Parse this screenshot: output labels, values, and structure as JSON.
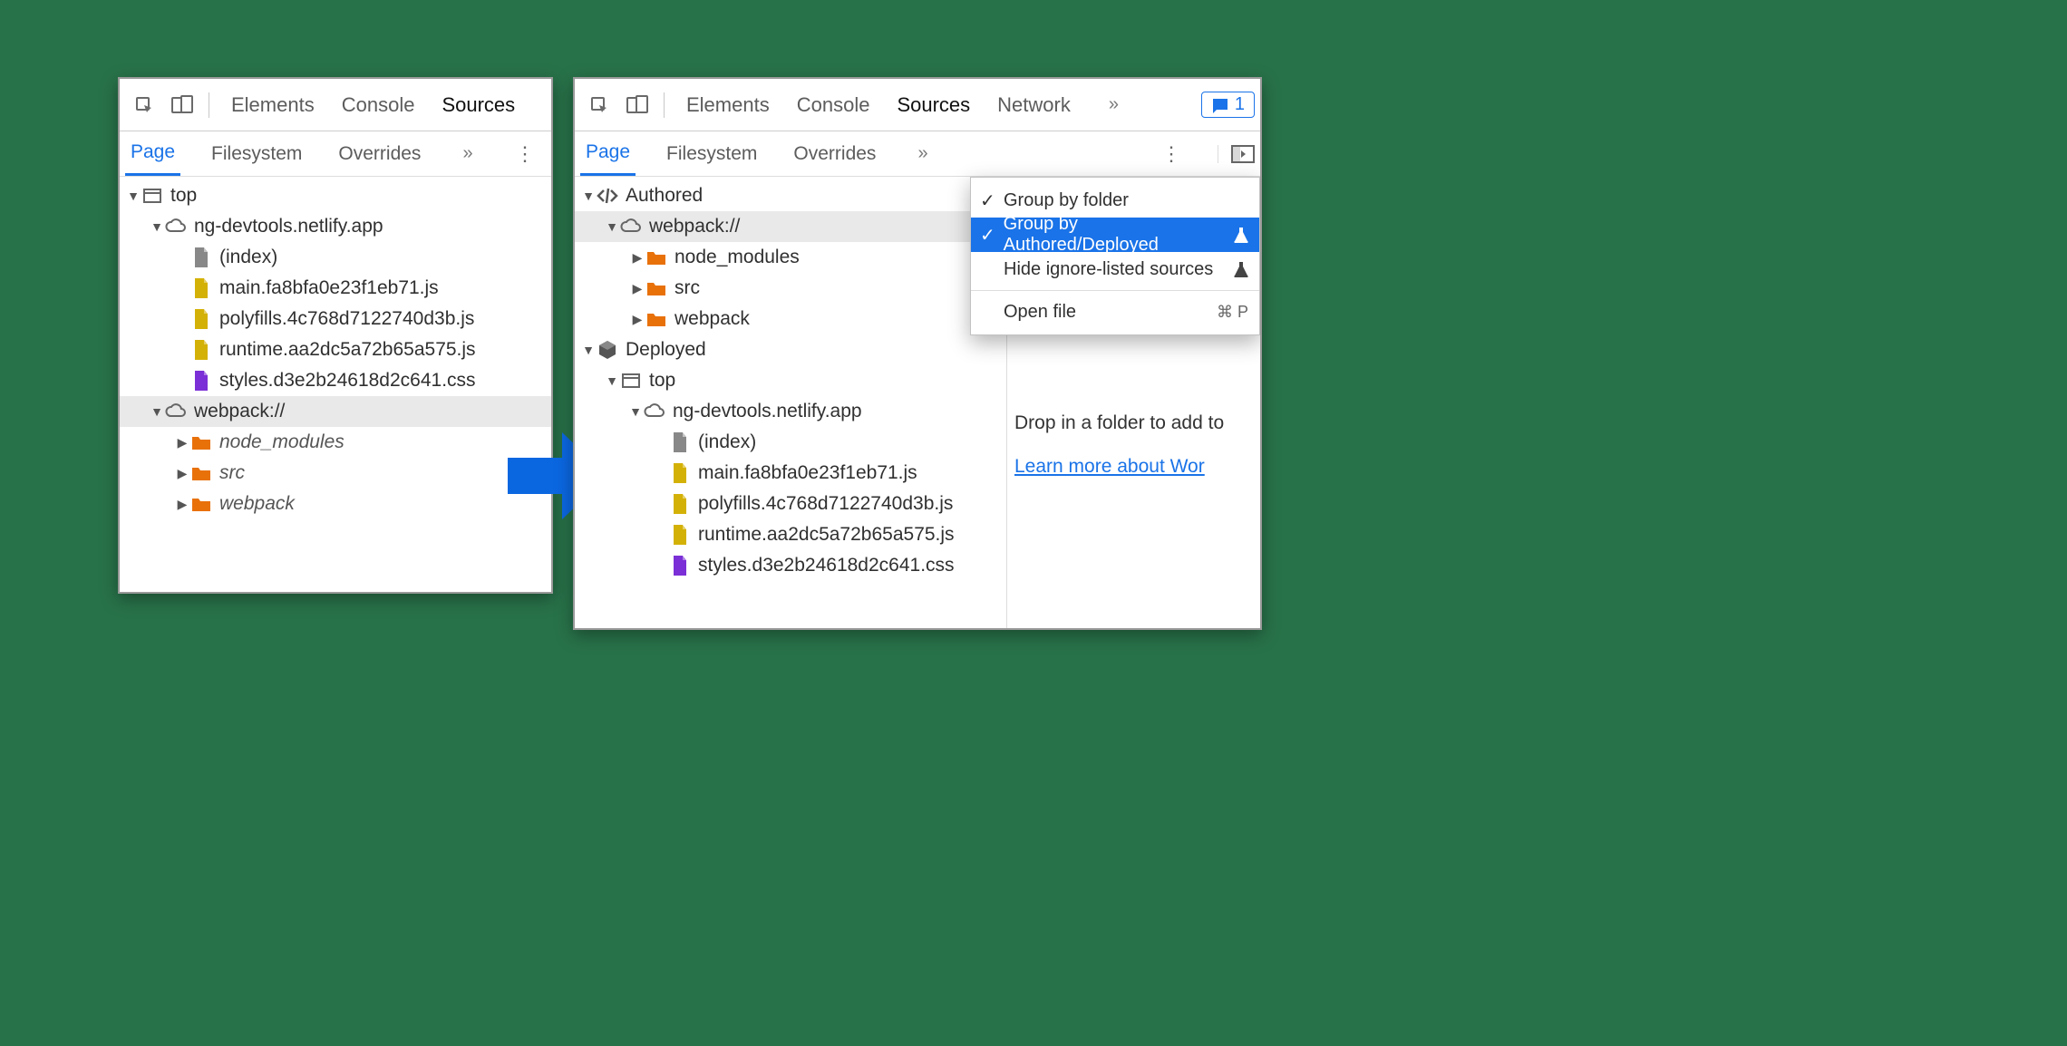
{
  "left": {
    "main_tabs": [
      "Elements",
      "Console",
      "Sources"
    ],
    "main_active": "Sources",
    "sub_tabs": [
      "Page",
      "Filesystem",
      "Overrides"
    ],
    "sub_active": "Page",
    "tree": {
      "top": "top",
      "domain": "ng-devtools.netlify.app",
      "files": [
        {
          "name": "(index)",
          "type": "gray"
        },
        {
          "name": "main.fa8bfa0e23f1eb71.js",
          "type": "yellow"
        },
        {
          "name": "polyfills.4c768d7122740d3b.js",
          "type": "yellow"
        },
        {
          "name": "runtime.aa2dc5a72b65a575.js",
          "type": "yellow"
        },
        {
          "name": "styles.d3e2b24618d2c641.css",
          "type": "purple"
        }
      ],
      "webpack": "webpack://",
      "webpack_folders": [
        "node_modules",
        "src",
        "webpack"
      ]
    }
  },
  "right": {
    "main_tabs": [
      "Elements",
      "Console",
      "Sources",
      "Network"
    ],
    "main_active": "Sources",
    "issues_count": "1",
    "sub_tabs": [
      "Page",
      "Filesystem",
      "Overrides"
    ],
    "sub_active": "Page",
    "tree": {
      "authored": "Authored",
      "webpack": "webpack://",
      "webpack_folders": [
        "node_modules",
        "src",
        "webpack"
      ],
      "deployed": "Deployed",
      "top": "top",
      "domain": "ng-devtools.netlify.app",
      "files": [
        {
          "name": "(index)",
          "type": "gray"
        },
        {
          "name": "main.fa8bfa0e23f1eb71.js",
          "type": "yellow"
        },
        {
          "name": "polyfills.4c768d7122740d3b.js",
          "type": "yellow"
        },
        {
          "name": "runtime.aa2dc5a72b65a575.js",
          "type": "yellow"
        },
        {
          "name": "styles.d3e2b24618d2c641.css",
          "type": "purple"
        }
      ]
    },
    "context_menu": {
      "items": [
        {
          "label": "Group by folder",
          "checked": true,
          "selected": false,
          "experiment": false
        },
        {
          "label": "Group by Authored/Deployed",
          "checked": true,
          "selected": true,
          "experiment": true
        },
        {
          "label": "Hide ignore-listed sources",
          "checked": false,
          "selected": false,
          "experiment": true
        }
      ],
      "open_file": "Open file",
      "open_file_shortcut": "⌘ P"
    },
    "hint": {
      "drop": "Drop in a folder to add to",
      "learn": "Learn more about Wor"
    }
  }
}
